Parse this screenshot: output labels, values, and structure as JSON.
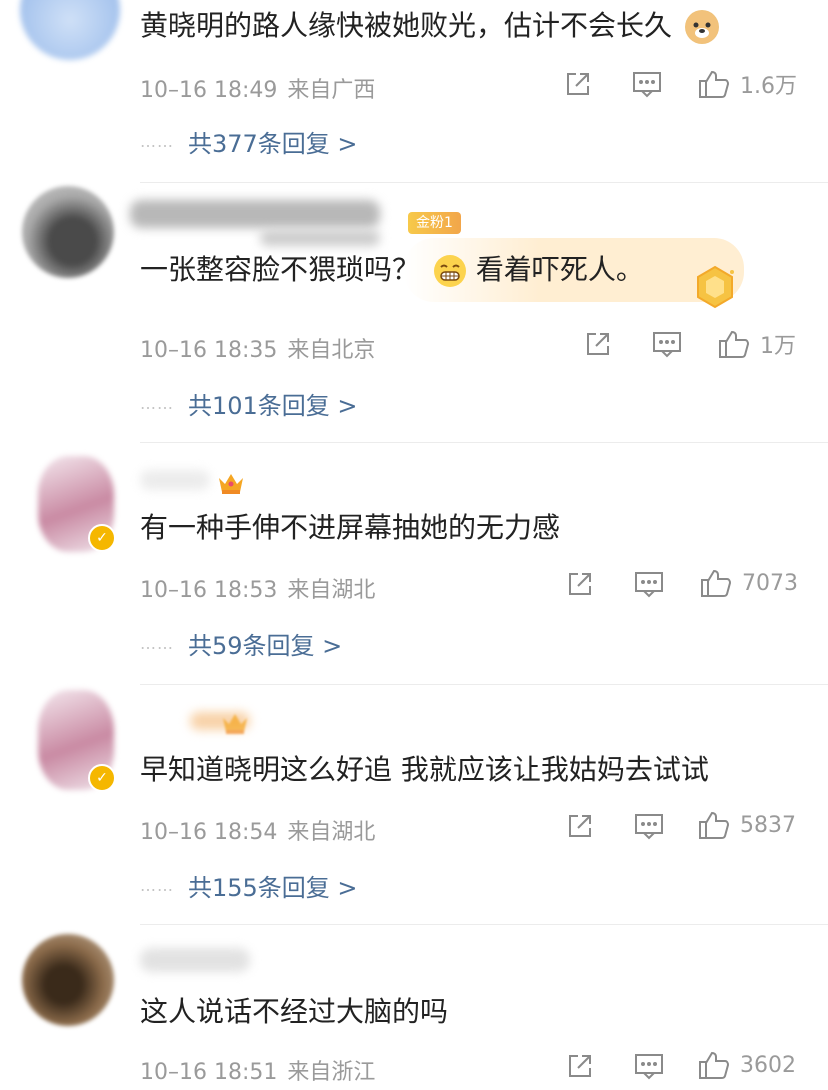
{
  "comments": [
    {
      "text": "黄晓明的路人缘快被她败光，估计不会长久",
      "time": "10–16 18:49",
      "location": "来自广西",
      "likes": "1.6万",
      "replies": "共377条回复 >"
    },
    {
      "text": "一张整容脸不猥琐吗？",
      "text2": "看着吓死人。",
      "badge": "金粉1",
      "time": "10–16 18:35",
      "location": "来自北京",
      "likes": "1万",
      "replies": "共101条回复 >"
    },
    {
      "text": "有一种手伸不进屏幕抽她的无力感",
      "time": "10–16 18:53",
      "location": "来自湖北",
      "likes": "7073",
      "replies": "共59条回复 >"
    },
    {
      "text": "早知道晓明这么好追 我就应该让我姑妈去试试",
      "time": "10–16 18:54",
      "location": "来自湖北",
      "likes": "5837",
      "replies": "共155条回复 >"
    },
    {
      "text": "这人说话不经过大脑的吗",
      "time": "10–16 18:51",
      "location": "来自浙江",
      "likes": "3602"
    }
  ],
  "reply_dots": "……",
  "colors": {
    "link": "#4a6d95",
    "meta": "#9a9a9a",
    "badge": "#f5b700"
  }
}
